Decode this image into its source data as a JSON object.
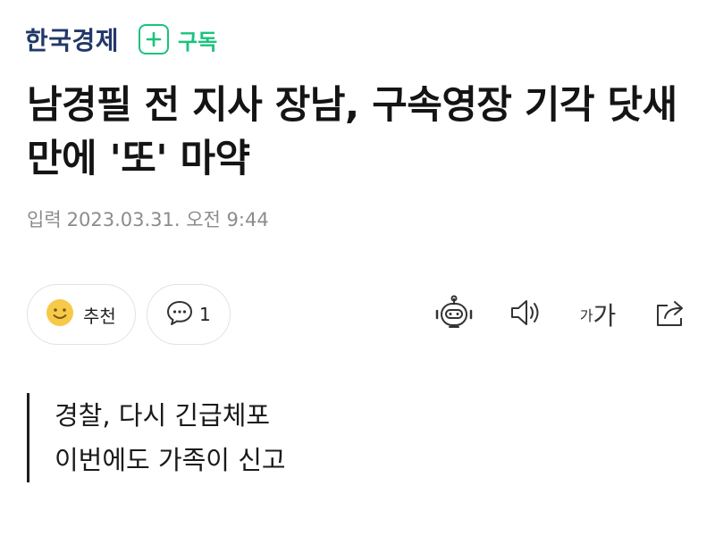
{
  "publisher": {
    "name": "한국경제",
    "subscribe_label": "구독"
  },
  "article": {
    "headline": "남경필 전 지사 장남, 구속영장 기각 닷새만에 '또' 마약",
    "date_label": "입력",
    "date_value": "2023.03.31. 오전 9:44"
  },
  "actions": {
    "recommend_label": "추천",
    "comment_count": "1",
    "font_small": "가",
    "font_large": "가"
  },
  "summary": [
    "경찰, 다시 긴급체포",
    "이번에도 가족이 신고"
  ],
  "colors": {
    "brand": "#22386a",
    "subscribe_green": "#19c37d",
    "meta_gray": "#8c8c8c"
  }
}
